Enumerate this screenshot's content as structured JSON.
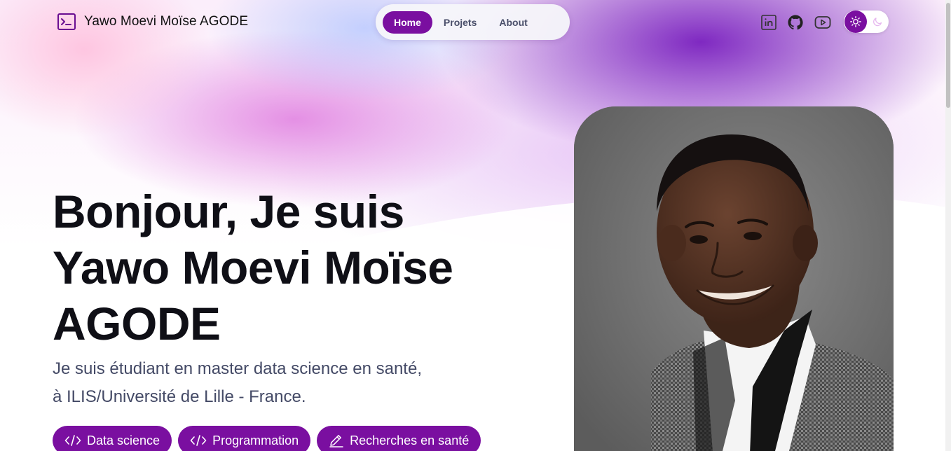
{
  "brand": {
    "name": "Yawo Moevi Moïse AGODE",
    "icon": "terminal-icon"
  },
  "nav": {
    "items": [
      "Home",
      "Projets",
      "About"
    ],
    "active": "Home"
  },
  "socials": [
    "linkedin-icon",
    "github-icon",
    "youtube-icon"
  ],
  "theme": {
    "mode": "light",
    "icons": [
      "sun-icon",
      "moon-icon"
    ]
  },
  "hero": {
    "title_lines": [
      "Bonjour, Je suis",
      "Yawo Moevi Moïse",
      "AGODE"
    ],
    "subtitle_lines": [
      "Je suis étudiant en master data science en santé,",
      "à ILIS/Université de Lille - France."
    ],
    "tags": [
      {
        "label": "Data science",
        "icon": "code-icon"
      },
      {
        "label": "Programmation",
        "icon": "code-icon"
      },
      {
        "label": "Recherches en santé",
        "icon": "pencil-icon"
      }
    ]
  },
  "colors": {
    "accent": "#7a0fa0",
    "text_dark": "#0f0f16",
    "text_muted": "#444a66"
  }
}
